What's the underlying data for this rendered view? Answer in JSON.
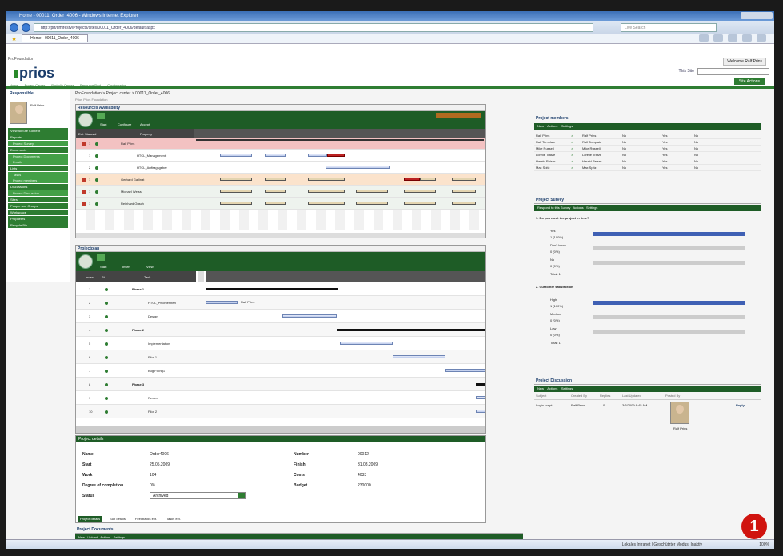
{
  "browser": {
    "title": "Home - 00011_Order_4006 - Windows Internet Explorer",
    "url": "http://prt/dmiresrv/Projects/sites/00011_Order_4006/default.aspx",
    "search_placeholder": "Live Search",
    "tab_label": "Home - 00011_Order_4006"
  },
  "header": {
    "site_title": "ProFoundation",
    "logo_text": "prios",
    "welcome": "Welcome Ralf Prins",
    "search_label": "This Site",
    "nav": [
      "Home",
      "Project Center",
      "Portfolio Center",
      "Resource Pool",
      "Configuration"
    ],
    "site_actions": "Site Actions"
  },
  "sidebar": {
    "heading": "Responsible",
    "person_name": "Ralf Prins",
    "items": [
      {
        "label": "View All Site Content",
        "kind": "section"
      },
      {
        "label": "Reports",
        "kind": "section"
      },
      {
        "label": "Project Survey",
        "kind": "sub"
      },
      {
        "label": "Documents",
        "kind": "section"
      },
      {
        "label": "Project Documents",
        "kind": "sub"
      },
      {
        "label": "Emails",
        "kind": "sub"
      },
      {
        "label": "Lists",
        "kind": "section"
      },
      {
        "label": "Tasks",
        "kind": "sub"
      },
      {
        "label": "Project members",
        "kind": "sub"
      },
      {
        "label": "Discussions",
        "kind": "section"
      },
      {
        "label": "Project Discussion",
        "kind": "sub"
      },
      {
        "label": "Sites",
        "kind": "section"
      },
      {
        "label": "People and Groups",
        "kind": "section"
      },
      {
        "label": "Workspace",
        "kind": "section"
      },
      {
        "label": "Proprietes",
        "kind": "section"
      },
      {
        "label": "Recycle Bin",
        "kind": "section"
      }
    ]
  },
  "breadcrumb": "ProFoundation > Project center > 00011_Order_4006",
  "breadcrumb_sub": "Prios Prios Foundation",
  "resource": {
    "title": "Resources Availability",
    "toolbar": [
      "Start",
      "Configure",
      "Accept"
    ],
    "columns": [
      "Ext. Status",
      "Id",
      "Property"
    ],
    "rows": [
      {
        "id": "1",
        "name": "Ralf Prins",
        "type": "summary"
      },
      {
        "id": "1",
        "name": "HTCL_Managementt",
        "type": "task"
      },
      {
        "id": "2",
        "name": "HTCL_Auftragsgeber",
        "type": "task"
      },
      {
        "id": "1",
        "name": "Gerhard Gallinat",
        "type": "summary2"
      },
      {
        "id": "1",
        "name": "Michael Weiss",
        "type": "summary3"
      },
      {
        "id": "1",
        "name": "Reinhard Gusch",
        "type": "summary3"
      }
    ]
  },
  "gantt": {
    "title": "Projectplan",
    "toolbar": [
      "Start",
      "Insert",
      "View"
    ],
    "columns": [
      "Index",
      "St",
      "Task"
    ],
    "rows": [
      {
        "id": "1",
        "name": "Phase 1",
        "level": 0
      },
      {
        "id": "2",
        "name": "HTCL_Pflichtenheft",
        "level": 1
      },
      {
        "id": "3",
        "name": "Design",
        "level": 1
      },
      {
        "id": "4",
        "name": "Phase 2",
        "level": 0
      },
      {
        "id": "5",
        "name": "Implementation",
        "level": 1
      },
      {
        "id": "6",
        "name": "Pilot 1",
        "level": 1
      },
      {
        "id": "7",
        "name": "Bug Fixing1",
        "level": 1
      },
      {
        "id": "8",
        "name": "Phase 3",
        "level": 0
      },
      {
        "id": "9",
        "name": "Review",
        "level": 1
      },
      {
        "id": "10",
        "name": "Pilot 2",
        "level": 1
      }
    ],
    "bar_note": "Ralf Prins"
  },
  "details": {
    "title": "Project details",
    "name_label": "Name",
    "name_value": "Order4006",
    "start_label": "Start",
    "start_value": "25.05.2009",
    "work_label": "Work",
    "work_value": "104",
    "completion_label": "Degree of completion",
    "completion_value": "0%",
    "status_label": "Status",
    "status_value": "Archived",
    "number_label": "Number",
    "number_value": "00012",
    "finish_label": "Finish",
    "finish_value": "31.08.2009",
    "costs_label": "Costs",
    "costs_value": "4033",
    "budget_label": "Budget",
    "budget_value": "230000",
    "tabs": [
      "Project details",
      "Sub details",
      "Feedbacks ext.",
      "Tasks ext."
    ]
  },
  "documents": {
    "title": "Project Documents",
    "toolbar": [
      "New",
      "Upload",
      "Actions",
      "Settings"
    ]
  },
  "members": {
    "title": "Project members",
    "toolbar": [
      "New",
      "Actions",
      "Settings"
    ],
    "rows": [
      {
        "a": "Ralf Prins",
        "b": "Ralf Prins",
        "c": "No",
        "d": "Yes",
        "e": "No"
      },
      {
        "a": "Ralf Template",
        "b": "Ralf Template",
        "c": "No",
        "d": "Yes",
        "e": "No"
      },
      {
        "a": "Mike Russell",
        "b": "Mike Russell",
        "c": "No",
        "d": "Yes",
        "e": "No"
      },
      {
        "a": "Lorelle Tratze",
        "b": "Lorelle Tratze",
        "c": "No",
        "d": "Yes",
        "e": "No"
      },
      {
        "a": "Harald Reiser",
        "b": "Harald Reiser",
        "c": "No",
        "d": "Yes",
        "e": "No"
      },
      {
        "a": "Max Spitz",
        "b": "Max Spitz",
        "c": "No",
        "d": "Yes",
        "e": "No"
      }
    ]
  },
  "survey": {
    "title": "Project Survey",
    "toolbar": [
      "Respond to this Survey",
      "Actions",
      "Settings"
    ],
    "q1": "1. Do you meet the project in time?",
    "q1_answers": [
      {
        "label": "Yes",
        "pct": "1 (100%)",
        "value": 1.0
      },
      {
        "label": "Don't know",
        "pct": "0 (0%)",
        "value": 0.0
      },
      {
        "label": "No",
        "pct": "0 (0%)",
        "value": 0.0
      }
    ],
    "q1_total": "Total: 1",
    "q2": "2. Customer satisfaction",
    "q2_answers": [
      {
        "label": "High",
        "pct": "1 (100%)",
        "value": 1.0
      },
      {
        "label": "Medium",
        "pct": "0 (0%)",
        "value": 0.0
      },
      {
        "label": "Low",
        "pct": "0 (0%)",
        "value": 0.0
      }
    ],
    "q2_total": "Total: 1"
  },
  "discussion": {
    "title": "Project Discussion",
    "toolbar": [
      "New",
      "Actions",
      "Settings"
    ],
    "columns": [
      "Subject",
      "Created By",
      "Replies",
      "Last Updated",
      "Posted By"
    ],
    "row": {
      "subject": "Login script",
      "by": "Ralf Prins",
      "replies": "0",
      "updated": "3/3/2009 8:45 AM",
      "poster": "Ralf Prins",
      "reply": "Reply"
    }
  },
  "status": {
    "zone": "Lokales Intranet | Geschützter Modus: Inaktiv",
    "zoom": "100%"
  },
  "callout": "1",
  "colors": {
    "green": "#2e7d32",
    "darkgreen": "#1e5c26",
    "blue_bar": "#3f60b4",
    "red": "#c0392b",
    "callout": "#d0140f"
  }
}
